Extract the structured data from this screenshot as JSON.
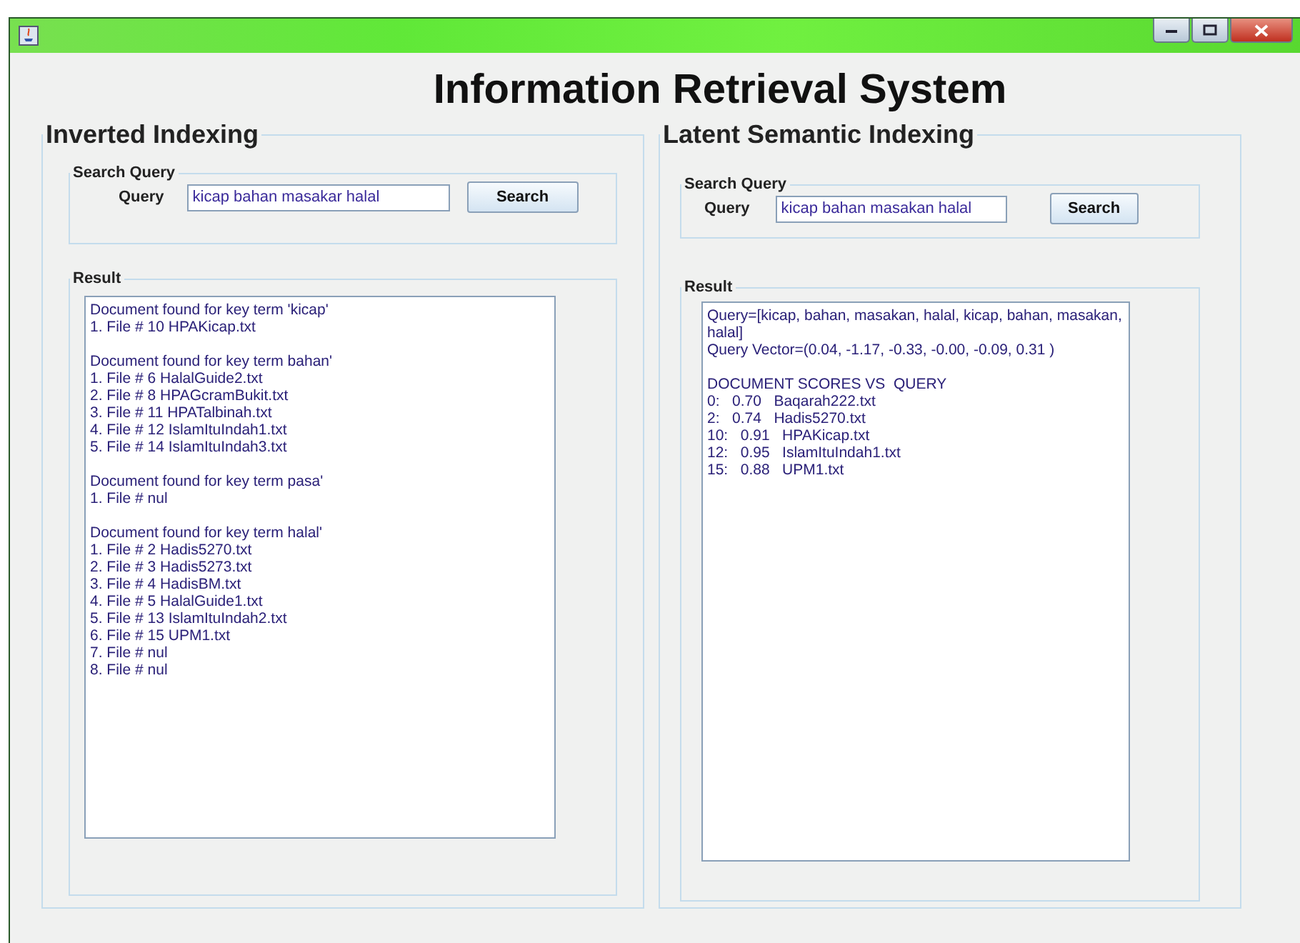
{
  "window": {
    "title": "Information Retrieval System"
  },
  "panels": [
    {
      "title": "Inverted Indexing",
      "search": {
        "title": "Search Query",
        "label": "Query",
        "value": "kicap bahan masakar halal",
        "button": "Search"
      },
      "result": {
        "title": "Result",
        "groups": [
          [
            "Document found for key term 'kicap'",
            "1. File # 10 HPAKicap.txt"
          ],
          [
            "Document found for key term bahan'",
            "1. File # 6 HalalGuide2.txt",
            "2. File # 8 HPAGcramBukit.txt",
            "3. File # 11 HPATalbinah.txt",
            "4. File # 12 IslamItuIndah1.txt",
            "5. File # 14 IslamItuIndah3.txt"
          ],
          [
            "Document found for key term pasa'",
            "1. File # nul"
          ],
          [
            "Document found for key term halal'",
            "1. File # 2 Hadis5270.txt",
            "2. File # 3 Hadis5273.txt",
            "3. File # 4 HadisBM.txt",
            "4. File # 5 HalalGuide1.txt",
            "5. File # 13 IslamItuIndah2.txt",
            "6. File # 15 UPM1.txt",
            "7. File # nul",
            "8. File # nul"
          ]
        ]
      }
    },
    {
      "title": "Latent Semantic Indexing",
      "search": {
        "title": "Search Query",
        "label": "Query",
        "value": "kicap bahan masakan halal",
        "button": "Search"
      },
      "result": {
        "title": "Result",
        "groups": [
          [
            "Query=[kicap, bahan, masakan, halal, kicap, bahan, masakan, halal]",
            "Query Vector=(0.04, -1.17, -0.33, -0.00, -0.09, 0.31 )"
          ],
          [
            "DOCUMENT SCORES VS  QUERY",
            "0:   0.70   Baqarah222.txt",
            "2:   0.74   Hadis5270.txt",
            "10:   0.91   HPAKicap.txt",
            "12:   0.95   IslamItuIndah1.txt",
            "15:   0.88   UPM1.txt"
          ]
        ]
      }
    }
  ]
}
